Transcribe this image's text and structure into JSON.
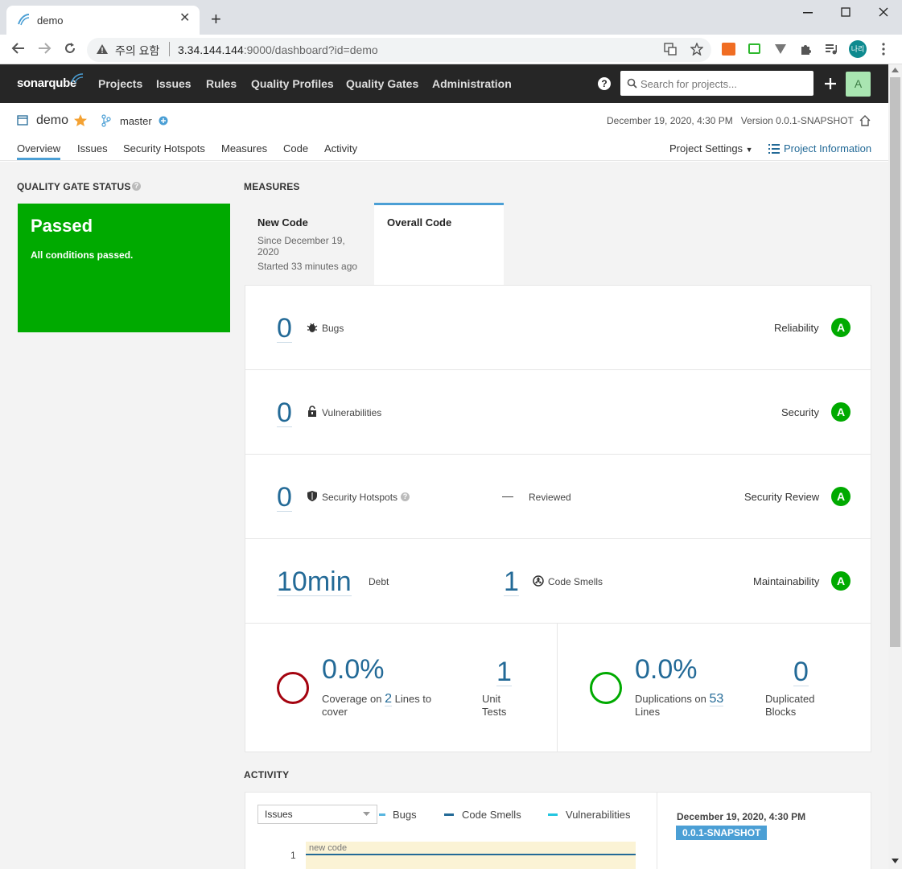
{
  "browser": {
    "tab_title": "demo",
    "close": "✕",
    "new_tab": "+",
    "warning_label": "주의 요함",
    "url_host": "3.34.144.144",
    "url_rest": ":9000/dashboard?id=demo",
    "profile_label": "나리"
  },
  "nav": {
    "logo": "sonarqube",
    "items": [
      "Projects",
      "Issues",
      "Rules",
      "Quality Profiles",
      "Quality Gates",
      "Administration"
    ],
    "search_placeholder": "Search for projects...",
    "avatar": "A"
  },
  "project": {
    "name": "demo",
    "branch": "master",
    "date": "December 19, 2020, 4:30 PM",
    "version": "Version 0.0.1-SNAPSHOT",
    "tabs": [
      "Overview",
      "Issues",
      "Security Hotspots",
      "Measures",
      "Code",
      "Activity"
    ],
    "settings": "Project Settings",
    "info": "Project Information"
  },
  "quality_gate": {
    "title": "QUALITY GATE STATUS",
    "status": "Passed",
    "subtitle": "All conditions passed.",
    "color": "#00aa00"
  },
  "measures": {
    "title": "MEASURES",
    "new_code": {
      "label": "New Code",
      "since": "Since December 19,",
      "since2": "2020",
      "started": "Started 33 minutes ago"
    },
    "overall_label": "Overall Code",
    "bugs": {
      "value": "0",
      "label": "Bugs",
      "rating_label": "Reliability",
      "rating": "A"
    },
    "vulnerabilities": {
      "value": "0",
      "label": "Vulnerabilities",
      "rating_label": "Security",
      "rating": "A"
    },
    "hotspots": {
      "value": "0",
      "label": "Security Hotspots",
      "reviewed_value": "—",
      "reviewed_label": "Reviewed",
      "rating_label": "Security Review",
      "rating": "A"
    },
    "debt": {
      "value": "10min",
      "label": "Debt",
      "smells_value": "1",
      "smells_label": "Code Smells",
      "rating_label": "Maintainability",
      "rating": "A"
    },
    "coverage": {
      "value": "0.0%",
      "prefix": "Coverage on",
      "lines": "2",
      "suffix": "Lines to",
      "suffix2": "cover",
      "unit_tests_value": "1",
      "unit_tests_label": "Unit",
      "unit_tests_label2": "Tests"
    },
    "duplications": {
      "value": "0.0%",
      "prefix": "Duplications on",
      "lines": "53",
      "suffix": "Lines",
      "blocks_value": "0",
      "blocks_label": "Duplicated",
      "blocks_label2": "Blocks"
    }
  },
  "activity": {
    "title": "ACTIVITY",
    "select_value": "Issues",
    "legend": [
      "Bugs",
      "Code Smells",
      "Vulnerabilities"
    ],
    "y_tick": "1",
    "new_code_label": "new code",
    "date": "December 19, 2020, 4:30 PM",
    "version": "0.0.1-SNAPSHOT"
  }
}
